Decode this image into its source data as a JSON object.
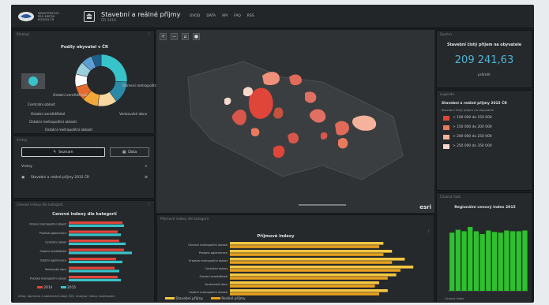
{
  "header": {
    "org_lines": [
      "MINISTERSTVO",
      "PRO MÍSTNÍ",
      "ROZVOJ ČR"
    ],
    "title": "Stavební a reálné příjmy",
    "subtitle": "ČR 2015",
    "nav": [
      "ÚVOD",
      "DATA",
      "API",
      "FAQ",
      "RSS"
    ]
  },
  "left_top": {
    "panel_title": "Přehled",
    "chart_title": "Podíly obyvatel v ČR",
    "labels": [
      "Okresní metropolitní region",
      "Ostatní zemědělské",
      "Centrální oblast",
      "Venkovské obce",
      "Ostatní zemědělské",
      "Ostatní metropolitní oblasti",
      "Ostatní metropolitní oblasti"
    ]
  },
  "left_mid": {
    "panel_title": "Vrstvy",
    "btn_primary": "Seznam",
    "btn_secondary": "Data",
    "section": "Vrstvy",
    "layer_item": "Stavební a reálné příjmy 2015 ČR"
  },
  "left_bottom": {
    "panel_title": "Cenové indexy dle kategorií",
    "chart_title": "Cenové indexy dle kategorií",
    "legend": [
      "2014",
      "2015"
    ],
    "footnote": "Zdroj: Agentura a statistické údaje ČSÚ, Analýza: Sekce modelování"
  },
  "center_bottom": {
    "panel_title": "Příjmové indexy dle kategorií",
    "chart_title": "Příjmové indexy",
    "legend": [
      "Stavební příjmy",
      "Reálné příjmy"
    ]
  },
  "right_top": {
    "panel_title": "Souhrn",
    "kpi_label": "Stavební čistý příjem na obyvatele",
    "kpi_value": "209 241,63",
    "kpi_unit": "průměr"
  },
  "right_mid": {
    "panel_title": "Legenda",
    "legend_title": "Stavební a reálné příjmy 2015 ČR",
    "legend_sub": "Stavební čistý příjem na obyvatele",
    "items": [
      "< 100 000 do 150 000",
      "> 150 000 do 200 000",
      "> 200 000 do 250 000",
      "> 250 000 do 350 000"
    ],
    "colors": [
      "#e0453a",
      "#ea7a5c",
      "#f4b39a",
      "#f6d8cc"
    ]
  },
  "right_bottom": {
    "panel_title": "Časová řada",
    "chart_title": "Regionální cenový index 2015",
    "bar_color": "#2ec12e",
    "values": [
      0.82,
      0.86,
      0.84,
      0.9,
      0.84,
      0.8,
      0.85,
      0.83,
      0.82,
      0.85,
      0.84,
      0.84,
      0.85
    ],
    "footnote": "Cenový index"
  },
  "map": {
    "attribution": "esri",
    "tools": [
      "+",
      "−",
      "⌂",
      "●"
    ]
  },
  "charts": {
    "left_bars": {
      "categories": [
        "Okresní metropolitní oblasti",
        "Pražská aglomerace",
        "Centrální oblast",
        "Ostatní zemědělské",
        "Ostatní aglomerace",
        "Venkovské obce",
        "Pražská metropolitní oblast"
      ],
      "series": [
        {
          "name": "2014",
          "values": [
            0.68,
            0.62,
            0.64,
            0.7,
            0.6,
            0.58,
            0.62
          ]
        },
        {
          "name": "2015",
          "values": [
            0.7,
            0.66,
            0.72,
            0.8,
            0.68,
            0.64,
            0.66
          ]
        }
      ],
      "colors": [
        "#e0453a",
        "#36c3c9"
      ]
    },
    "center_bars": {
      "categories": [
        "Okresní metropolitní oblasti",
        "Pražská aglomerace",
        "Pražská metropolitní oblast",
        "Centrální oblast",
        "Ostatní zemědělské",
        "Venkovské obce",
        "Ostatní metropolitní oblasti"
      ],
      "series": [
        {
          "name": "Stavební příjmy",
          "values": [
            0.72,
            0.76,
            0.82,
            0.86,
            0.78,
            0.7,
            0.74
          ]
        },
        {
          "name": "Reálné příjmy",
          "values": [
            0.7,
            0.72,
            0.76,
            0.8,
            0.74,
            0.68,
            0.7
          ]
        }
      ],
      "colors": [
        "#f5c842",
        "#e7a11f"
      ]
    },
    "donut": {
      "slices": [
        {
          "value": 26,
          "color": "#36c3c9"
        },
        {
          "value": 14,
          "color": "#2b8aa8"
        },
        {
          "value": 12,
          "color": "#f6d8a0"
        },
        {
          "value": 10,
          "color": "#f0a83a"
        },
        {
          "value": 9,
          "color": "#e46b2d"
        },
        {
          "value": 8,
          "color": "#ffffff"
        },
        {
          "value": 8,
          "color": "#9ad0de"
        },
        {
          "value": 7,
          "color": "#5d9fd3"
        },
        {
          "value": 6,
          "color": "#1f5f8b"
        }
      ]
    }
  }
}
